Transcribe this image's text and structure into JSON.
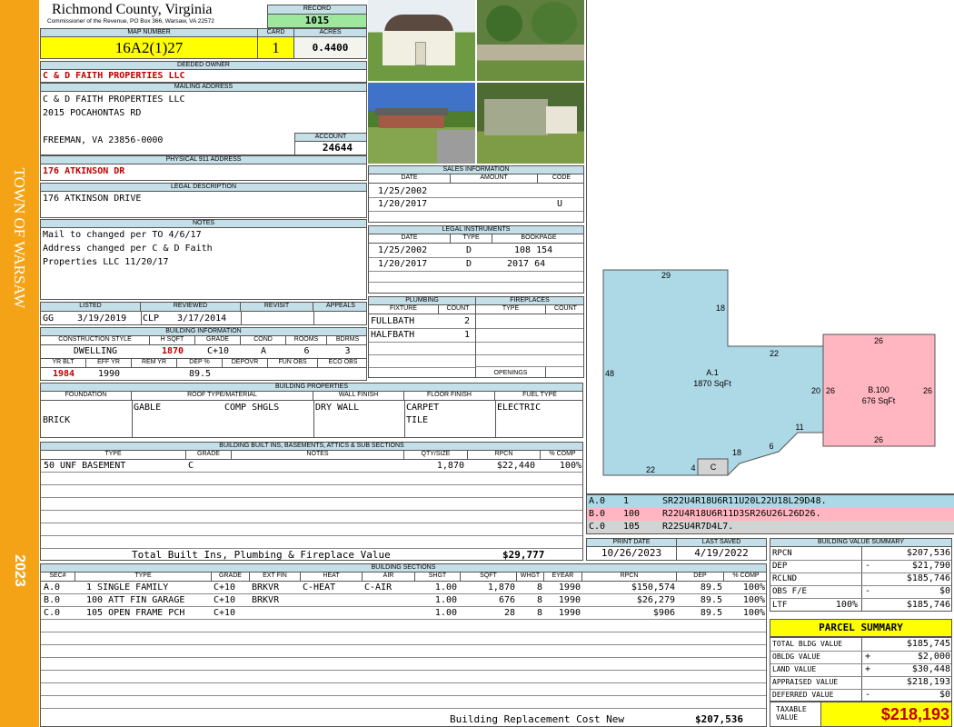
{
  "sidebar": {
    "town": "TOWN OF WARSAW",
    "year": "2023"
  },
  "header": {
    "county": "Richmond County, Virginia",
    "commissioner": "Commissioner of the Revenue, PO Box 366, Warsaw, VA 22572",
    "record_label": "RECORD",
    "record": "1015",
    "map_label": "MAP NUMBER",
    "map_number": "16A2(1)27",
    "card_label": "CARD",
    "card": "1",
    "acres_label": "ACRES",
    "acres": "0.4400"
  },
  "owner": {
    "deeded_label": "DEEDED OWNER",
    "deeded_owner": "C & D FAITH PROPERTIES LLC",
    "mailing_label": "MAILING ADDRESS",
    "mailing": [
      "C & D FAITH PROPERTIES LLC",
      "2015 POCAHONTAS RD",
      "",
      "FREEMAN, VA 23856-0000"
    ],
    "account_label": "ACCOUNT",
    "account": "24644",
    "physical_label": "PHYSICAL 911 ADDRESS",
    "physical": "176 ATKINSON DR"
  },
  "legal": {
    "label": "LEGAL DESCRIPTION",
    "text": "176 ATKINSON DRIVE"
  },
  "notes": {
    "label": "NOTES",
    "lines": [
      "Mail to changed per TO 4/6/17",
      "Address changed per C & D Faith",
      "Properties LLC 11/20/17"
    ]
  },
  "sales": {
    "label": "SALES INFORMATION",
    "cols": [
      "DATE",
      "AMOUNT",
      "CODE"
    ],
    "rows": [
      {
        "date": "1/25/2002",
        "amount": "",
        "code": ""
      },
      {
        "date": "1/20/2017",
        "amount": "",
        "code": "U"
      }
    ]
  },
  "legal_instruments": {
    "label": "LEGAL INSTRUMENTS",
    "cols": [
      "DATE",
      "TYPE",
      "BOOKPAGE"
    ],
    "rows": [
      {
        "date": "1/25/2002",
        "type": "D",
        "bookpage": "108 154"
      },
      {
        "date": "1/20/2017",
        "type": "D",
        "bookpage": "2017 64"
      }
    ]
  },
  "listed": {
    "cols": [
      "LISTED",
      "REVIEWED",
      "REVISIT",
      "APPEALS"
    ],
    "listed_by": "GG",
    "listed_date": "3/19/2019",
    "reviewed_by": "CLP",
    "reviewed_date": "3/17/2014"
  },
  "building_info": {
    "label": "BUILDING INFORMATION",
    "cols": [
      "CONSTRUCTION STYLE",
      "H SQFT",
      "GRADE",
      "COND",
      "ROOMS",
      "BDRMS"
    ],
    "style": "DWELLING",
    "hsqft": "1870",
    "grade": "C+10",
    "cond": "A",
    "rooms": "6",
    "bdrms": "3",
    "cols2": [
      "YR BLT",
      "EFF YR",
      "REM YR",
      "DEP %",
      "DEPOVR",
      "FUN OBS",
      "ECO OBS"
    ],
    "yr_blt": "1984",
    "eff_yr": "1990",
    "rem_yr": "",
    "dep": "89.5"
  },
  "plumbing": {
    "label": "PLUMBING",
    "cols": [
      "FIXTURE",
      "COUNT"
    ],
    "rows": [
      {
        "fixture": "FULLBATH",
        "count": "2"
      },
      {
        "fixture": "HALFBATH",
        "count": "1"
      }
    ]
  },
  "fireplaces": {
    "label": "FIREPLACES",
    "cols": [
      "TYPE",
      "COUNT"
    ],
    "openings": "OPENINGS"
  },
  "properties": {
    "label": "BUILDING PROPERTIES",
    "cols": [
      "FOUNDATION",
      "ROOF TYPE/MATERIAL",
      "WALL FINISH",
      "FLOOR FINISH",
      "FUEL TYPE"
    ],
    "foundation": "BRICK",
    "roof_type": "GABLE",
    "roof_mat": "COMP SHGLS",
    "wall": "DRY WALL",
    "floor": [
      "CARPET",
      "TILE"
    ],
    "fuel": "ELECTRIC"
  },
  "builtins": {
    "label": "BUILDING BUILT INS, BASEMENTS, ATTICS & SUB SECTIONS",
    "cols": [
      "TYPE",
      "GRADE",
      "NOTES",
      "QTY/SIZE",
      "RPCN",
      "% COMP"
    ],
    "rows": [
      {
        "type": "50 UNF BASEMENT",
        "grade": "C",
        "notes": "",
        "qty": "1,870",
        "rpcn": "$22,440",
        "comp": "100%"
      }
    ],
    "total_label": "Total Built Ins, Plumbing & Fireplace Value",
    "total": "$29,777"
  },
  "sketch": {
    "labels": {
      "top": "29",
      "r1": "18",
      "mid": "22",
      "left": "48",
      "r2": "20",
      "b1": "11",
      "b2": "6",
      "b3": "18",
      "b4": "4",
      "b5": "22",
      "b_top": "26",
      "b_left": "26",
      "b_right": "26",
      "b_bot": "26",
      "c": "C",
      "a_name": "A.1",
      "a_sqft": "1870 SqFt",
      "b_name": "B.100",
      "b_sqft": "676 SqFt"
    },
    "colors": {
      "a": "#add8e6",
      "b": "#ffb6c1",
      "c": "#d3d3d3"
    },
    "vectors": [
      {
        "id": "A.0",
        "code": "1",
        "vec": "SR22U4R18U6R11U20L22U18L29D48."
      },
      {
        "id": "B.0",
        "code": "100",
        "vec": "R22U4R18U6R11D3SR26U26L26D26."
      },
      {
        "id": "C.0",
        "code": "105",
        "vec": "R22SU4R7D4L7."
      }
    ]
  },
  "dates": {
    "print_label": "PRINT DATE",
    "print": "10/26/2023",
    "saved_label": "LAST SAVED",
    "saved": "4/19/2022"
  },
  "sections": {
    "label": "BUILDING SECTIONS",
    "cols": [
      "SEC#",
      "TYPE",
      "GRADE",
      "EXT FIN",
      "HEAT",
      "AIR",
      "SHGT",
      "SQFT",
      "WHGT",
      "EYEAR",
      "RPCN",
      "DEP",
      "% COMP"
    ],
    "rows": [
      {
        "sec": "A.0",
        "type": "1 SINGLE FAMILY",
        "grade": "C+10",
        "ext": "BRKVR",
        "heat": "C-HEAT",
        "air": "C-AIR",
        "shgt": "1.00",
        "sqft": "1,870",
        "whgt": "8",
        "eyear": "1990",
        "rpcn": "$150,574",
        "dep": "89.5",
        "comp": "100%"
      },
      {
        "sec": "B.0",
        "type": "100 ATT FIN GARAGE",
        "grade": "C+10",
        "ext": "BRKVR",
        "heat": "",
        "air": "",
        "shgt": "1.00",
        "sqft": "676",
        "whgt": "8",
        "eyear": "1990",
        "rpcn": "$26,279",
        "dep": "89.5",
        "comp": "100%"
      },
      {
        "sec": "C.0",
        "type": "105 OPEN FRAME PCH",
        "grade": "C+10",
        "ext": "",
        "heat": "",
        "air": "",
        "shgt": "1.00",
        "sqft": "28",
        "whgt": "8",
        "eyear": "1990",
        "rpcn": "$906",
        "dep": "89.5",
        "comp": "100%"
      }
    ],
    "total_label": "Building Replacement Cost New",
    "total": "$207,536"
  },
  "value_summary": {
    "label": "BUILDING VALUE SUMMARY",
    "rows": [
      {
        "k": "RPCN",
        "sign": "",
        "v": "$207,536"
      },
      {
        "k": "DEP",
        "sign": "-",
        "v": "$21,790"
      },
      {
        "k": "RCLND",
        "sign": "",
        "v": "$185,746"
      },
      {
        "k": "OBS F/E",
        "sign": "-",
        "v": "$0"
      },
      {
        "k": "LTF",
        "sign": "100%",
        "v": "$185,746"
      }
    ]
  },
  "parcel": {
    "label": "PARCEL SUMMARY",
    "rows": [
      {
        "k": "TOTAL BLDG VALUE",
        "sign": "",
        "v": "$185,745"
      },
      {
        "k": "OBLDG VALUE",
        "sign": "+",
        "v": "$2,000"
      },
      {
        "k": "LAND VALUE",
        "sign": "+",
        "v": "$30,448"
      },
      {
        "k": "APPRAISED VALUE",
        "sign": "",
        "v": "$218,193"
      },
      {
        "k": "DEFERRED VALUE",
        "sign": "-",
        "v": "$0"
      }
    ],
    "taxable_label": "TAXABLE VALUE",
    "taxable": "$218,193"
  },
  "colors": {
    "sidebar": "#f5a316",
    "header": "#c5dfe8",
    "yellow": "#ffff00",
    "green": "#9ee89e",
    "red": "#c00000"
  }
}
